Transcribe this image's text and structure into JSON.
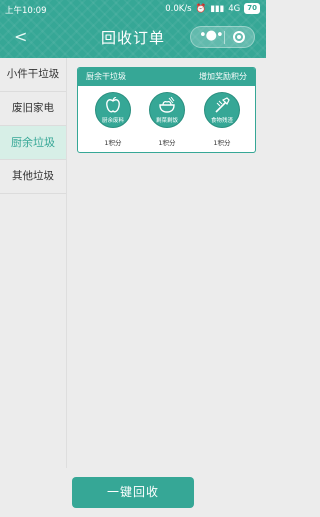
{
  "status": {
    "time": "上午10:09",
    "speed": "0.0K/s",
    "network": "4G",
    "battery": "70"
  },
  "nav": {
    "title": "回收订单"
  },
  "sidebar": {
    "items": [
      {
        "label": "小件干垃圾"
      },
      {
        "label": "废旧家电"
      },
      {
        "label": "厨余垃圾"
      },
      {
        "label": "其他垃圾"
      }
    ]
  },
  "card": {
    "title": "厨余干垃圾",
    "bonus_label": "增加奖励积分",
    "items": [
      {
        "label": "厨余废料",
        "points": "1积分"
      },
      {
        "label": "剩菜剩饭",
        "points": "1积分"
      },
      {
        "label": "食物残渣",
        "points": "1积分"
      }
    ]
  },
  "footer": {
    "button_label": "一键回收"
  },
  "colors": {
    "accent": "#36a796"
  }
}
